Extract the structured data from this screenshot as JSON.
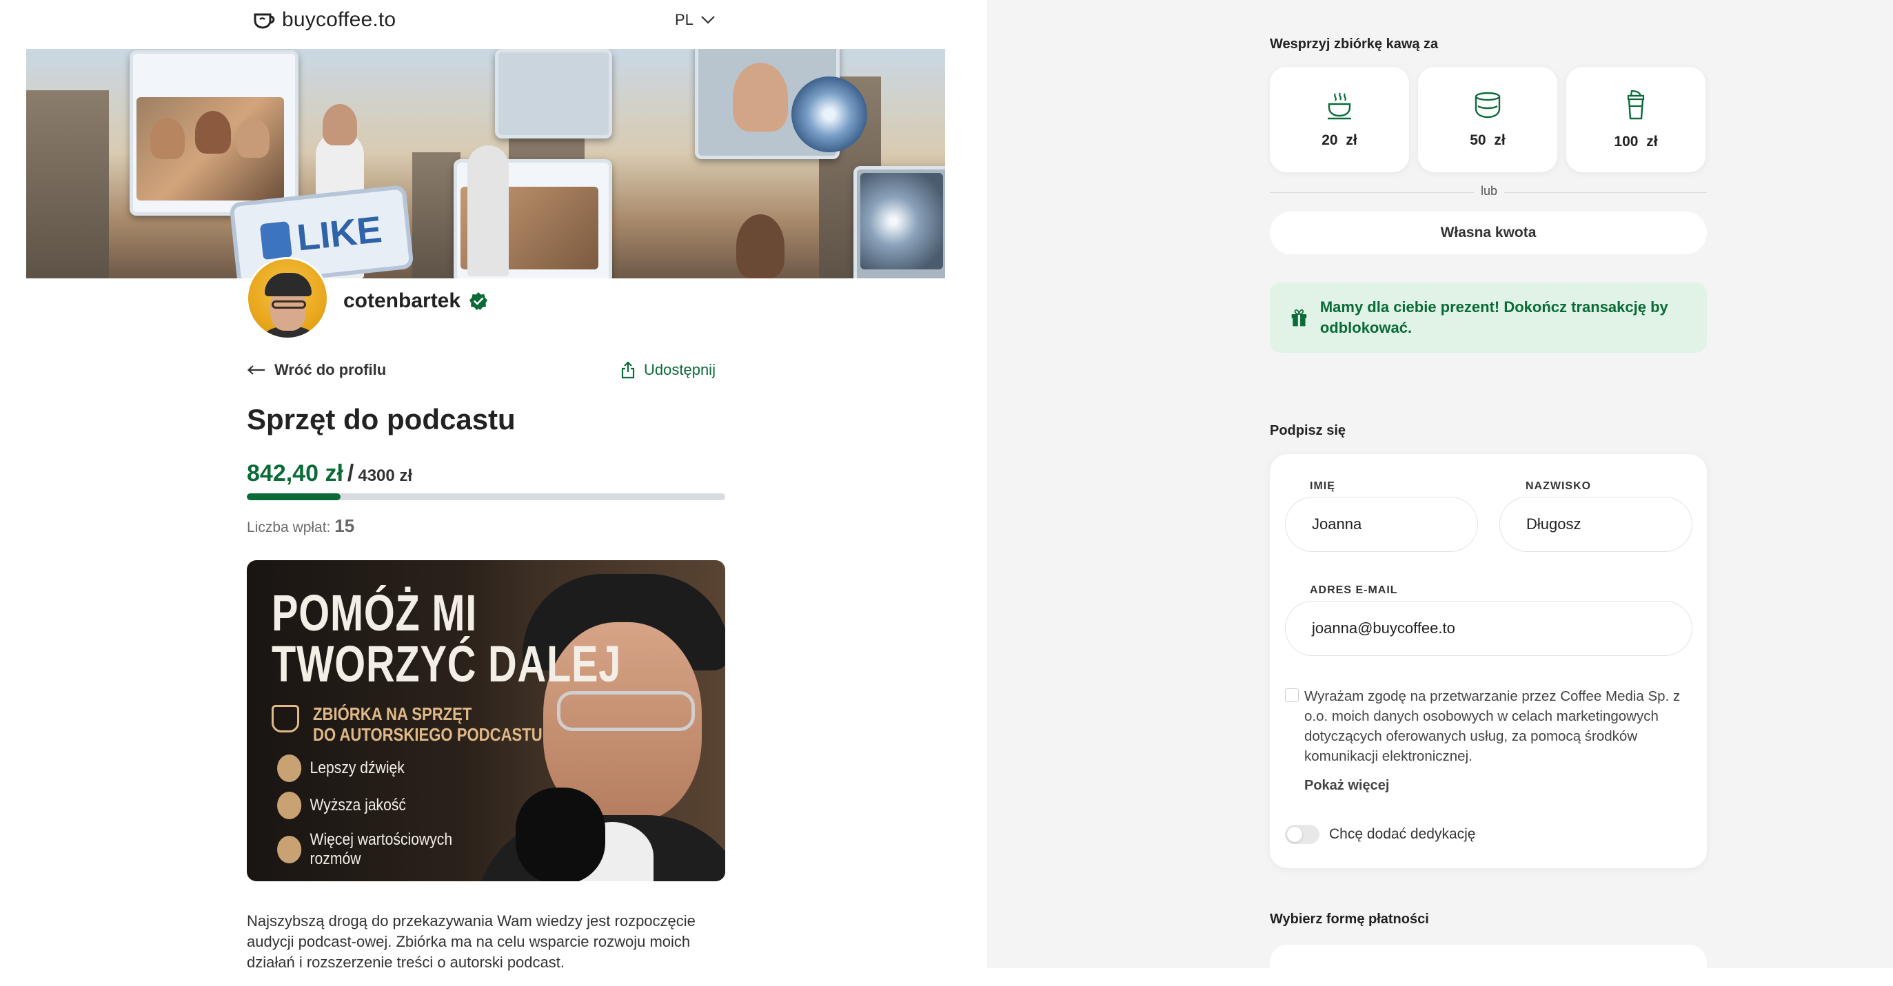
{
  "header": {
    "logo_text": "buycoffee.to",
    "language": "PL"
  },
  "profile": {
    "creator_name": "cotenbartek",
    "back_label": "Wróć do profilu",
    "share_label": "Udostępnij"
  },
  "fundraiser": {
    "title": "Sprzęt do podcastu",
    "raised": "842,40 zł",
    "separator": "/",
    "goal": "4300 zł",
    "progress_fraction": 0.196,
    "contributions_label": "Liczba wpłat:",
    "contributions_count": "15",
    "poster": {
      "headline_1": "POMÓŻ MI",
      "headline_2": "TWORZYĆ DALEJ",
      "subline": "ZBIÓRKA NA SPRZĘT\nDO AUTORSKIEGO PODCASTU",
      "items": [
        "Lepszy dźwięk",
        "Wyższa jakość",
        "Więcej wartościowych\nrozmów"
      ]
    },
    "description": "Najszybszą drogą do przekazywania Wam wiedzy jest rozpoczęcie audycji podcast-owej. Zbiórka ma na celu wsparcie rozwoju moich działań i rozszerzenie treści o autorski podcast."
  },
  "support": {
    "section_label": "Wesprzyj zbiórkę kawą za",
    "tiles": [
      {
        "amount": "20 zł",
        "icon": "steaming-cup-icon"
      },
      {
        "amount": "50 zł",
        "icon": "coffee-mug-icon"
      },
      {
        "amount": "100 zł",
        "icon": "takeaway-cup-icon"
      }
    ],
    "or_label": "lub",
    "custom_amount_label": "Własna kwota",
    "gift_message": "Mamy dla ciebie prezent! Dokończ transakcję by odblokować."
  },
  "sign": {
    "section_label": "Podpisz się",
    "first_name_label": "IMIĘ",
    "first_name_value": "Joanna",
    "last_name_label": "NAZWISKO",
    "last_name_value": "Długosz",
    "email_label": "ADRES E-MAIL",
    "email_value": "joanna@buycoffee.to",
    "consent_text": "Wyrażam zgodę na przetwarzanie przez Coffee Media Sp. z o.o. moich danych osobowych w celach marketingowych dotyczących oferowanych usług, za pomocą środków komunikacji elektronicznej.",
    "show_more_label": "Pokaż więcej",
    "dedication_label": "Chcę dodać dedykację"
  },
  "payment": {
    "section_label": "Wybierz formę płatności"
  },
  "colors": {
    "brand_green": "#0a6b38",
    "gift_bg": "#e1f2e6",
    "right_bg": "#f4f4f4"
  }
}
